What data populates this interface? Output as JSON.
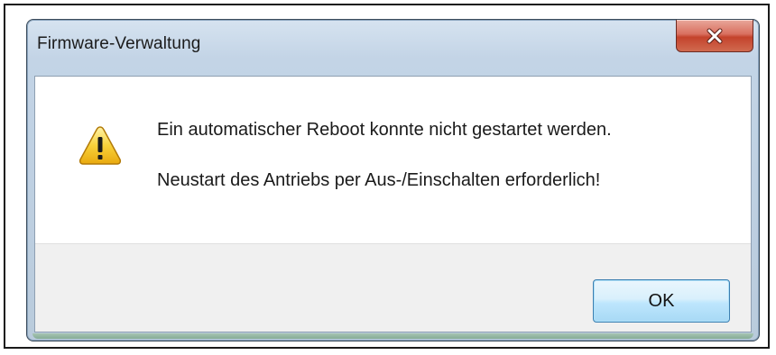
{
  "window": {
    "title": "Firmware-Verwaltung",
    "close_icon": "close-x-icon",
    "close_button_color": "#c4432c"
  },
  "message": {
    "icon": "warning-triangle-icon",
    "icon_color": "#f5c518",
    "line1": "Ein automatischer Reboot konnte nicht gestartet werden.",
    "line2": "Neustart des Antriebs per Aus-/Einschalten erforderlich!"
  },
  "buttons": {
    "ok_label": "OK",
    "ok_accent": "#3c7fb1"
  }
}
